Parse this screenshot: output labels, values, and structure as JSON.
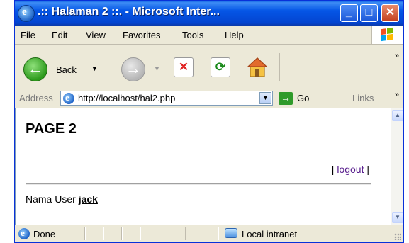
{
  "window": {
    "title": ".:: Halaman 2 ::. - Microsoft Inter...",
    "minimize_label": "_",
    "maximize_label": "□",
    "close_label": "✕"
  },
  "menu": {
    "items": [
      {
        "label": "File"
      },
      {
        "label": "Edit"
      },
      {
        "label": "View"
      },
      {
        "label": "Favorites"
      },
      {
        "label": "Tools"
      },
      {
        "label": "Help"
      }
    ]
  },
  "toolbar": {
    "back_label": "Back",
    "more": "»"
  },
  "address": {
    "label": "Address",
    "value": "http://localhost/hal2.php",
    "go_label": "Go",
    "links_label": "Links",
    "more": "»"
  },
  "page": {
    "heading": "PAGE 2",
    "logout_prefix": "| ",
    "logout_link": "logout",
    "logout_suffix": " |",
    "user_label": "Nama User ",
    "user_name": "jack"
  },
  "status": {
    "text": "Done",
    "zone": "Local intranet"
  },
  "colors": {
    "title_bar": "#0556e6",
    "link_visited": "#551a8b",
    "chrome": "#ece9d8"
  }
}
